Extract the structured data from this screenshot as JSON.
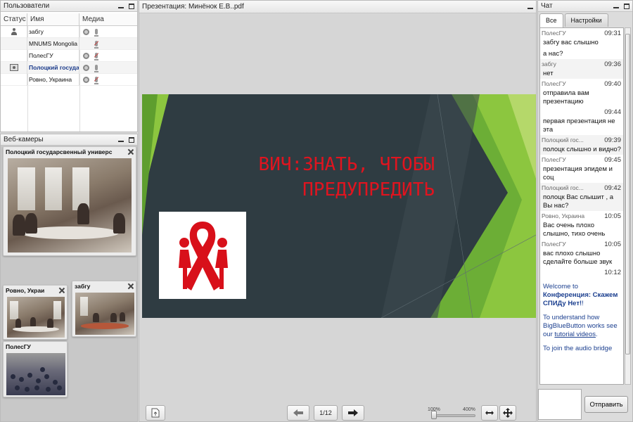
{
  "users": {
    "title": "Пользователи",
    "columns": {
      "status": "Статус",
      "name": "Имя",
      "media": "Медиа"
    },
    "rows": [
      {
        "name": "забгу"
      },
      {
        "name": "MNUMS Mongolia"
      },
      {
        "name": "ПолесГУ"
      },
      {
        "name": "Полоцкий государ"
      },
      {
        "name": "Ровно, Украина"
      }
    ]
  },
  "webcams": {
    "title": "Веб-камеры",
    "windows": [
      {
        "title": "Полоцкий государсвенный универс"
      },
      {
        "title": "Ровно, Украи"
      },
      {
        "title": "забгу"
      },
      {
        "title": "ПолесГУ"
      }
    ]
  },
  "presentation": {
    "title": "Презентация: Минёнок Е.В..pdf",
    "slide_title_line1": "ВИЧ:ЗНАТЬ, ЧТОБЫ",
    "slide_title_line2": "ПРЕДУПРЕДИТЬ",
    "page": "1/12",
    "zoom_min": "100%",
    "zoom_max": "400%",
    "colors": {
      "slide_bg": "#2f3c42",
      "accent_green": "#8cc63f",
      "title_red": "#e0141f"
    }
  },
  "chat": {
    "title": "Чат",
    "tabs": [
      "Все",
      "Настройки"
    ],
    "messages": [
      {
        "sender": "ПолесГУ",
        "time": "09:31",
        "lines": [
          "забгу вас слышно",
          "а нас?"
        ]
      },
      {
        "sender": "забгу",
        "time": "09:36",
        "lines": [
          "нет"
        ]
      },
      {
        "sender": "ПолесГУ",
        "time": "09:40",
        "lines": [
          "отправила вам презентацию"
        ]
      },
      {
        "sender": "",
        "time": "09:44",
        "lines": [
          "первая презентация не эта"
        ]
      },
      {
        "sender": "Полоцкий гос...",
        "time": "09:39",
        "lines": [
          "полоцк слышно и видно?"
        ]
      },
      {
        "sender": "ПолесГУ",
        "time": "09:45",
        "lines": [
          "презентация эпидем и соц"
        ]
      },
      {
        "sender": "Полоцкий гос...",
        "time": "09:42",
        "lines": [
          "полоцк Вас слышит , а Вы нас?"
        ]
      },
      {
        "sender": "Ровно, Украина",
        "time": "10:05",
        "lines": [
          "Вас очень плохо слышно, тихо очень"
        ]
      },
      {
        "sender": "ПолесГУ",
        "time": "10:05",
        "lines": [
          "вас плохо слышно сделайте больше звук"
        ]
      },
      {
        "sender": "",
        "time": "10:12",
        "lines": []
      }
    ],
    "welcome": {
      "line1": "Welcome to",
      "conference": "Конференция: Скажем СПИДу Нет!",
      "bang": "!",
      "understand_pre": "To understand how BigBlueButton works see our ",
      "tutorial_link": "tutorial videos",
      "understand_post": ".",
      "audio": "To join the audio bridge"
    },
    "send_label": "Отправить"
  }
}
